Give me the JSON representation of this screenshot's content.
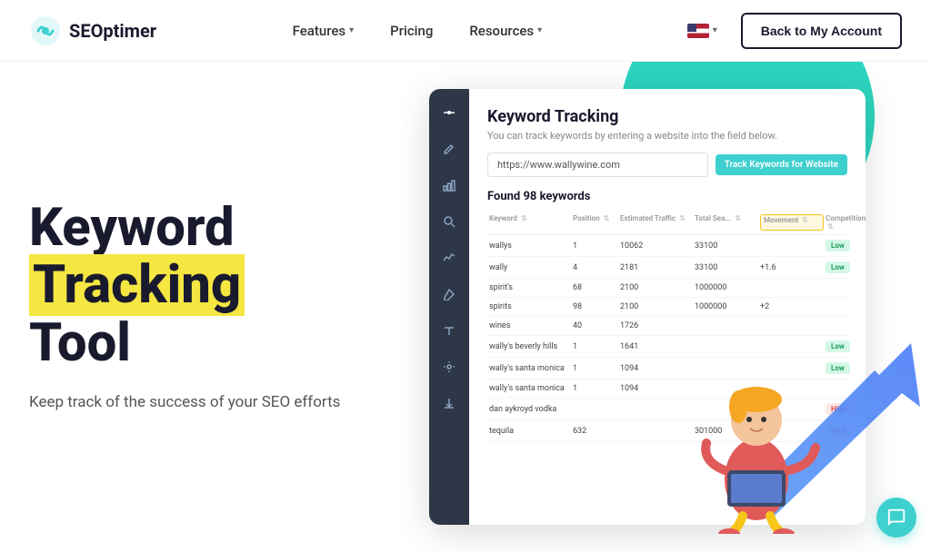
{
  "header": {
    "logo_text": "SEOptimer",
    "logo_text_se": "SE",
    "logo_text_optimizer": "Optimer",
    "nav": {
      "features_label": "Features",
      "pricing_label": "Pricing",
      "resources_label": "Resources"
    },
    "back_button_label": "Back to My Account"
  },
  "hero": {
    "title_line1": "Keyword",
    "title_line2": "Tracking",
    "title_line3": "Tool",
    "subtitle": "Keep track of the success of your SEO efforts"
  },
  "dashboard": {
    "title": "Keyword Tracking",
    "subtitle": "You can track keywords by entering a website into the field below.",
    "url_placeholder": "https://www.wallywine.com",
    "track_button": "Track Keywords for Website",
    "found_text": "Found 98 keywords",
    "table": {
      "headers": [
        "Keyword",
        "Position",
        "Estimated Traffic",
        "Total Sea...",
        "Movement",
        "Competition"
      ],
      "rows": [
        {
          "keyword": "wallys",
          "position": "1",
          "traffic": "10062",
          "total": "33100",
          "movement": "",
          "competition": "Low"
        },
        {
          "keyword": "wally",
          "position": "4",
          "traffic": "2181",
          "total": "33100",
          "movement": "+1.6",
          "competition": "Low"
        },
        {
          "keyword": "spirit's",
          "position": "68",
          "traffic": "2100",
          "total": "1000000",
          "movement": "",
          "competition": ""
        },
        {
          "keyword": "spirits",
          "position": "98",
          "traffic": "2100",
          "total": "1000000",
          "movement": "+2",
          "competition": ""
        },
        {
          "keyword": "wines",
          "position": "40",
          "traffic": "1726",
          "total": "",
          "movement": "",
          "competition": ""
        },
        {
          "keyword": "wally's beverly hills",
          "position": "1",
          "traffic": "1641",
          "total": "",
          "movement": "",
          "competition": "Low"
        },
        {
          "keyword": "wally's santa monica",
          "position": "1",
          "traffic": "1094",
          "total": "",
          "movement": "",
          "competition": "Low"
        },
        {
          "keyword": "wally's santa monica",
          "position": "1",
          "traffic": "1094",
          "total": "",
          "movement": "",
          "competition": ""
        },
        {
          "keyword": "dan aykroyd vodka",
          "position": "",
          "traffic": "",
          "total": "",
          "movement": "",
          "competition": "High"
        },
        {
          "keyword": "tequila",
          "position": "632",
          "traffic": "",
          "total": "301000",
          "movement": "",
          "competition": "High"
        }
      ]
    }
  },
  "chat_button_label": "Chat"
}
